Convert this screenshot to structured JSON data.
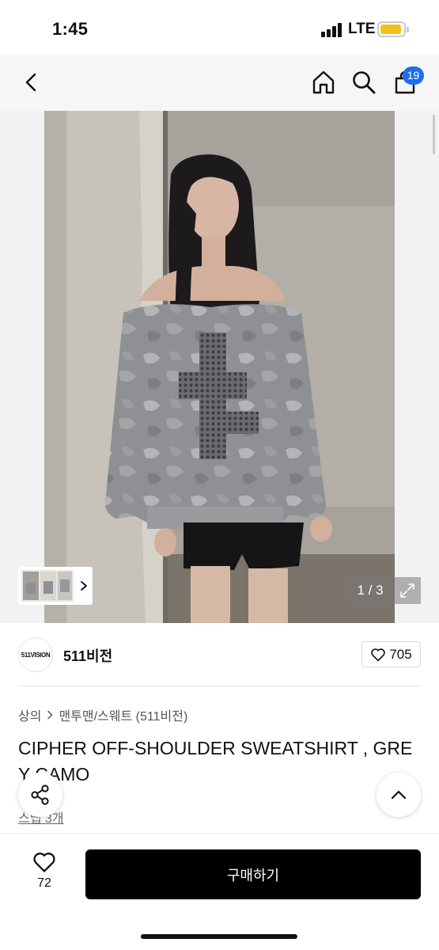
{
  "status_bar": {
    "time": "1:45",
    "network": "LTE",
    "battery_color": "#f2c21a"
  },
  "nav": {
    "back_icon": "chevron-left-icon",
    "home_icon": "home-icon",
    "search_icon": "search-icon",
    "cart_icon": "shopping-bag-icon",
    "cart_count": "19",
    "badge_color": "#1e6ff0"
  },
  "gallery": {
    "page_indicator": "1 / 3",
    "current_page": 1,
    "total_pages": 3,
    "expand_icon": "expand-icon",
    "thumbnail_icon": "chevron-right-icon"
  },
  "brand": {
    "logo_text": "511VISION",
    "name": "511비전",
    "like_icon": "heart-outline-icon",
    "like_count": "705"
  },
  "breadcrumb": {
    "category": "상의",
    "separator_icon": "chevron-right-icon",
    "subcategory": "맨투맨/스웨트 (511비전)"
  },
  "product": {
    "title": "CIPHER OFF-SHOULDER SWEATSHIRT , GREY CAMO",
    "review_link": "스냅 3개"
  },
  "floating": {
    "share_icon": "share-icon",
    "scroll_top_icon": "chevron-up-icon"
  },
  "bottom_bar": {
    "wish_icon": "heart-outline-icon",
    "wish_count": "72",
    "buy_label": "구매하기",
    "buy_color": "#000000"
  }
}
